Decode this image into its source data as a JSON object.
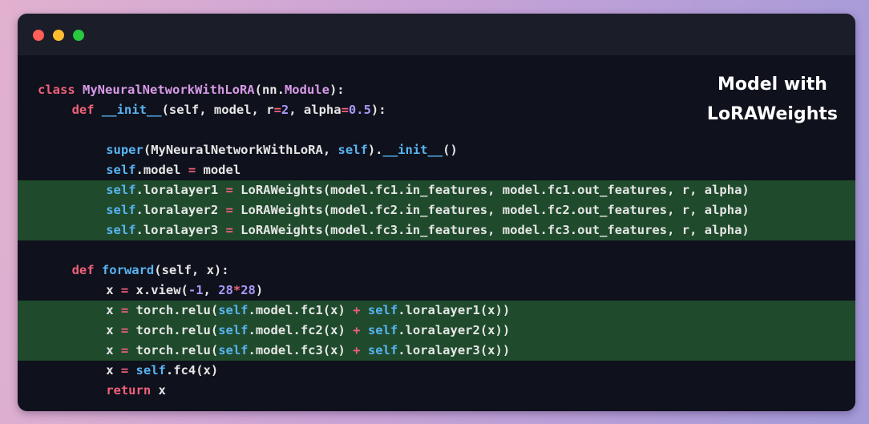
{
  "window": {
    "traffic_lights": [
      {
        "name": "close",
        "color": "#ff5f57"
      },
      {
        "name": "minimize",
        "color": "#febc2e"
      },
      {
        "name": "zoom",
        "color": "#28c840"
      }
    ]
  },
  "caption": {
    "line1": "Model with",
    "line2": "LoRAWeights"
  },
  "code": {
    "highlight_color": "#1f4a2c",
    "lines": [
      {
        "indent": 0,
        "highlight": false,
        "tokens": [
          {
            "t": "class ",
            "c": "kw"
          },
          {
            "t": "MyNeuralNetworkWithLoRA",
            "c": "cls"
          },
          {
            "t": "(nn.",
            "c": ""
          },
          {
            "t": "Module",
            "c": "cls"
          },
          {
            "t": "):",
            "c": ""
          }
        ]
      },
      {
        "indent": 4,
        "highlight": false,
        "tokens": [
          {
            "t": "def ",
            "c": "kw"
          },
          {
            "t": "__init__",
            "c": "fn"
          },
          {
            "t": "(self, model, r",
            "c": ""
          },
          {
            "t": "=",
            "c": "op"
          },
          {
            "t": "2",
            "c": "num"
          },
          {
            "t": ", alpha",
            "c": ""
          },
          {
            "t": "=",
            "c": "op"
          },
          {
            "t": "0.5",
            "c": "num"
          },
          {
            "t": "):",
            "c": ""
          }
        ]
      },
      {
        "indent": 0,
        "highlight": false,
        "tokens": []
      },
      {
        "indent": 8,
        "highlight": false,
        "tokens": [
          {
            "t": "super",
            "c": "fn"
          },
          {
            "t": "(MyNeuralNetworkWithLoRA, ",
            "c": ""
          },
          {
            "t": "self",
            "c": "self"
          },
          {
            "t": ").",
            "c": ""
          },
          {
            "t": "__init__",
            "c": "fn"
          },
          {
            "t": "()",
            "c": ""
          }
        ]
      },
      {
        "indent": 8,
        "highlight": false,
        "tokens": [
          {
            "t": "self",
            "c": "self"
          },
          {
            "t": ".model ",
            "c": ""
          },
          {
            "t": "=",
            "c": "op"
          },
          {
            "t": " model",
            "c": ""
          }
        ]
      },
      {
        "indent": 8,
        "highlight": true,
        "tokens": [
          {
            "t": "self",
            "c": "self"
          },
          {
            "t": ".loralayer1 ",
            "c": ""
          },
          {
            "t": "=",
            "c": "op"
          },
          {
            "t": " LoRAWeights(model.fc1.in_features, model.fc1.out_features, r, alpha)",
            "c": ""
          }
        ]
      },
      {
        "indent": 8,
        "highlight": true,
        "tokens": [
          {
            "t": "self",
            "c": "self"
          },
          {
            "t": ".loralayer2 ",
            "c": ""
          },
          {
            "t": "=",
            "c": "op"
          },
          {
            "t": " LoRAWeights(model.fc2.in_features, model.fc2.out_features, r, alpha)",
            "c": ""
          }
        ]
      },
      {
        "indent": 8,
        "highlight": true,
        "tokens": [
          {
            "t": "self",
            "c": "self"
          },
          {
            "t": ".loralayer3 ",
            "c": ""
          },
          {
            "t": "=",
            "c": "op"
          },
          {
            "t": " LoRAWeights(model.fc3.in_features, model.fc3.out_features, r, alpha)",
            "c": ""
          }
        ]
      },
      {
        "indent": 0,
        "highlight": false,
        "tokens": []
      },
      {
        "indent": 4,
        "highlight": false,
        "tokens": [
          {
            "t": "def ",
            "c": "kw"
          },
          {
            "t": "forward",
            "c": "fn"
          },
          {
            "t": "(self, x):",
            "c": ""
          }
        ]
      },
      {
        "indent": 8,
        "highlight": false,
        "tokens": [
          {
            "t": "x ",
            "c": ""
          },
          {
            "t": "=",
            "c": "op"
          },
          {
            "t": " x.view(",
            "c": ""
          },
          {
            "t": "-1",
            "c": "num"
          },
          {
            "t": ", ",
            "c": ""
          },
          {
            "t": "28",
            "c": "num"
          },
          {
            "t": "*",
            "c": "op"
          },
          {
            "t": "28",
            "c": "num"
          },
          {
            "t": ")",
            "c": ""
          }
        ]
      },
      {
        "indent": 8,
        "highlight": true,
        "tokens": [
          {
            "t": "x ",
            "c": ""
          },
          {
            "t": "=",
            "c": "op"
          },
          {
            "t": " torch.relu(",
            "c": ""
          },
          {
            "t": "self",
            "c": "self"
          },
          {
            "t": ".model.fc1(x) ",
            "c": ""
          },
          {
            "t": "+",
            "c": "op"
          },
          {
            "t": " ",
            "c": ""
          },
          {
            "t": "self",
            "c": "self"
          },
          {
            "t": ".loralayer1(x))",
            "c": ""
          }
        ]
      },
      {
        "indent": 8,
        "highlight": true,
        "tokens": [
          {
            "t": "x ",
            "c": ""
          },
          {
            "t": "=",
            "c": "op"
          },
          {
            "t": " torch.relu(",
            "c": ""
          },
          {
            "t": "self",
            "c": "self"
          },
          {
            "t": ".model.fc2(x) ",
            "c": ""
          },
          {
            "t": "+",
            "c": "op"
          },
          {
            "t": " ",
            "c": ""
          },
          {
            "t": "self",
            "c": "self"
          },
          {
            "t": ".loralayer2(x))",
            "c": ""
          }
        ]
      },
      {
        "indent": 8,
        "highlight": true,
        "tokens": [
          {
            "t": "x ",
            "c": ""
          },
          {
            "t": "=",
            "c": "op"
          },
          {
            "t": " torch.relu(",
            "c": ""
          },
          {
            "t": "self",
            "c": "self"
          },
          {
            "t": ".model.fc3(x) ",
            "c": ""
          },
          {
            "t": "+",
            "c": "op"
          },
          {
            "t": " ",
            "c": ""
          },
          {
            "t": "self",
            "c": "self"
          },
          {
            "t": ".loralayer3(x))",
            "c": ""
          }
        ]
      },
      {
        "indent": 8,
        "highlight": false,
        "tokens": [
          {
            "t": "x ",
            "c": ""
          },
          {
            "t": "=",
            "c": "op"
          },
          {
            "t": " ",
            "c": ""
          },
          {
            "t": "self",
            "c": "self"
          },
          {
            "t": ".fc4(x)",
            "c": ""
          }
        ]
      },
      {
        "indent": 8,
        "highlight": false,
        "tokens": [
          {
            "t": "return",
            "c": "kw"
          },
          {
            "t": " x",
            "c": ""
          }
        ]
      }
    ]
  }
}
